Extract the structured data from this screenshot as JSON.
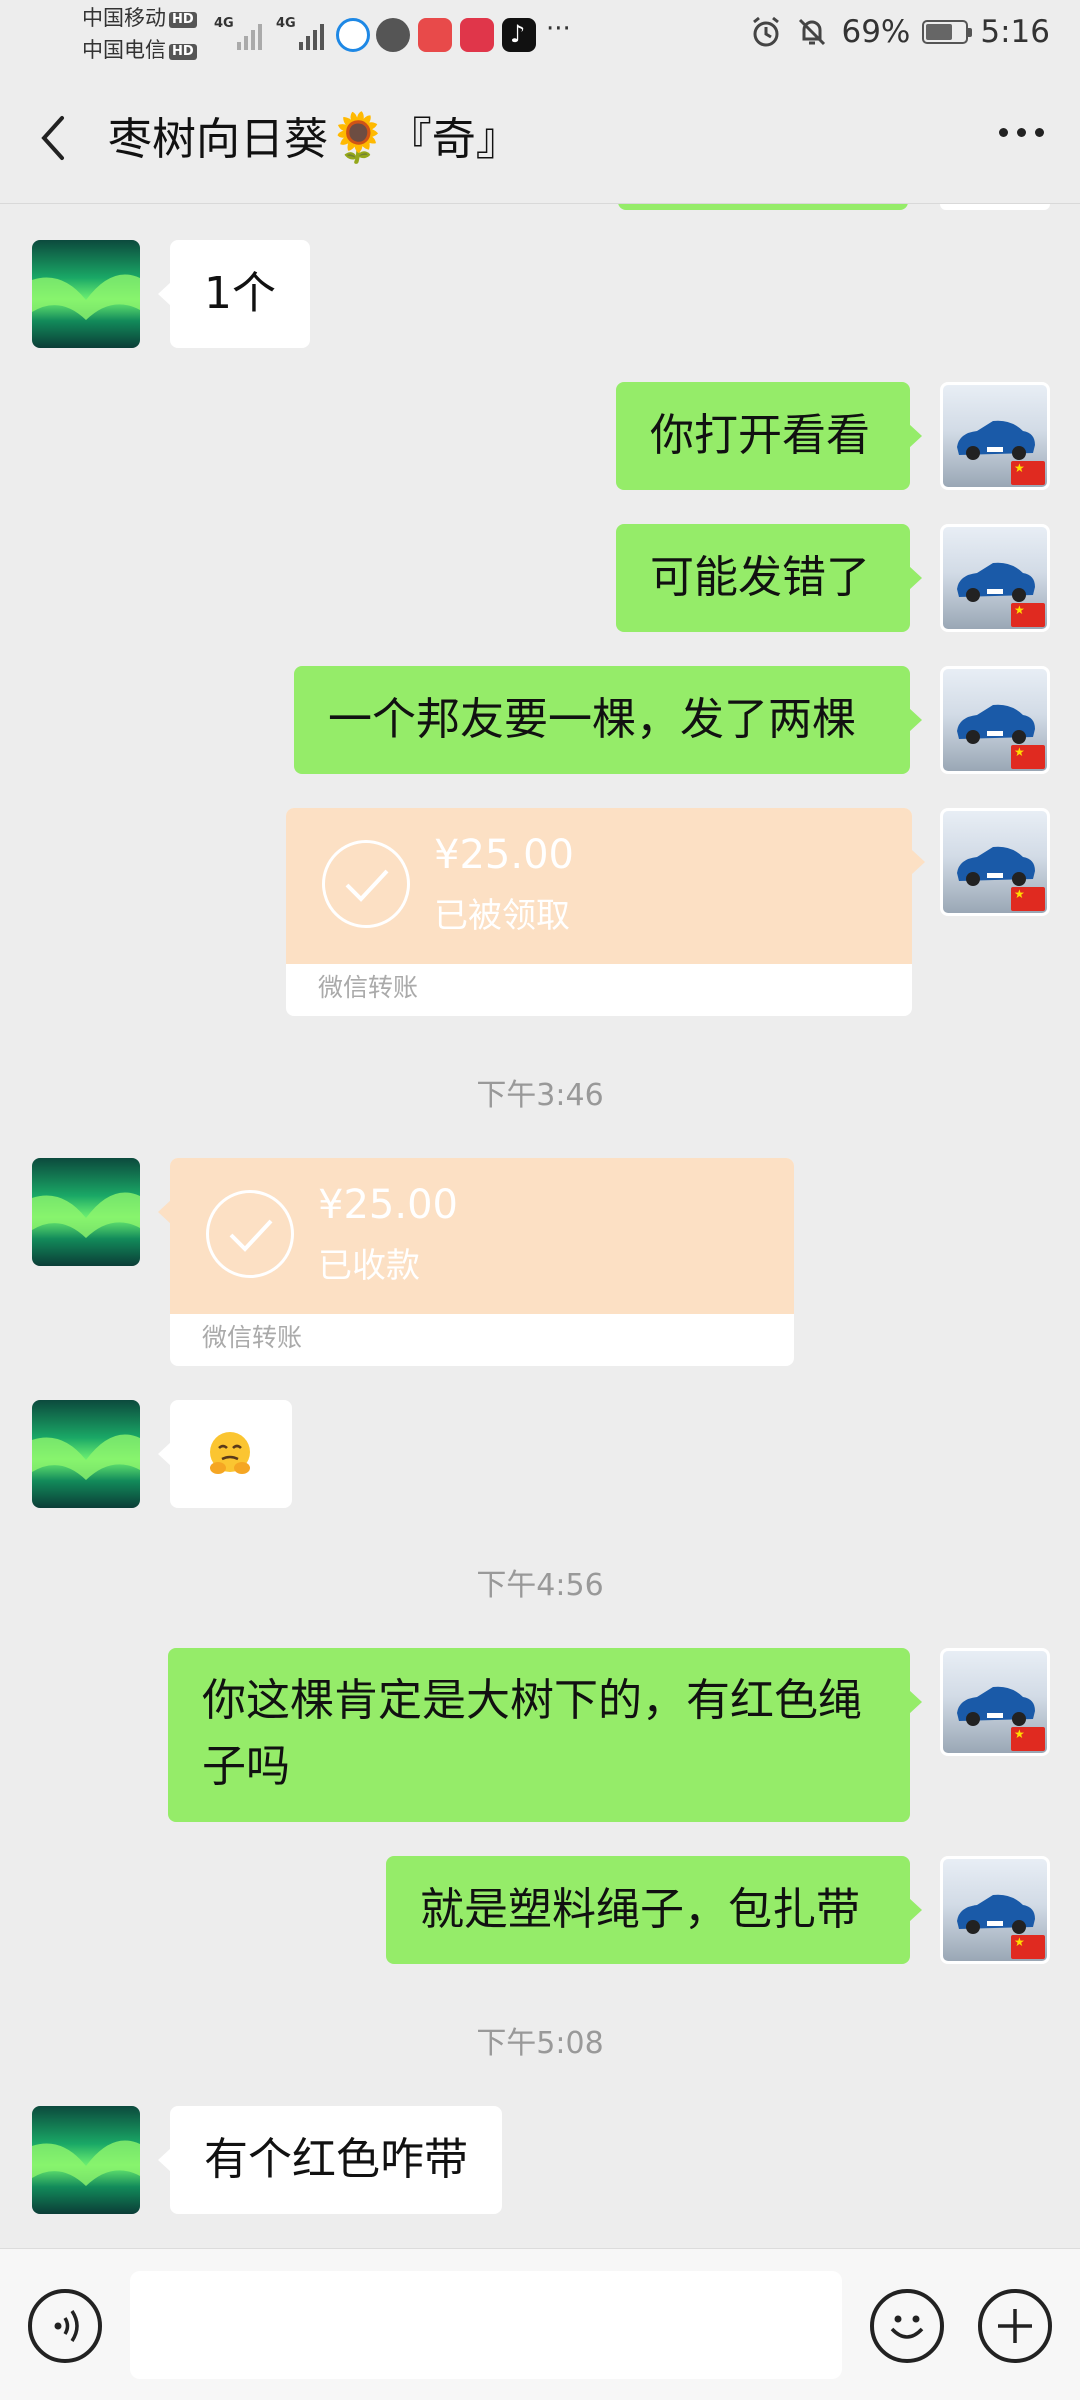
{
  "status_bar": {
    "carrier_1": "中国移动",
    "carrier_2": "中国电信",
    "hd_badge": "HD",
    "net_1": "4G",
    "net_2": "4G",
    "more_indicator": "···",
    "battery_percent": "69%",
    "time": "5:16",
    "battery_level": 0.69,
    "icons": [
      "alarm-icon",
      "mute-bell-icon",
      "battery-icon"
    ]
  },
  "header": {
    "title": "枣树向日葵",
    "title_emoji": "🌻",
    "title_suffix": "『奇』"
  },
  "messages": [
    {
      "side": "left",
      "type": "text",
      "text": "1个"
    },
    {
      "side": "right",
      "type": "text",
      "text": "你打开看看"
    },
    {
      "side": "right",
      "type": "text",
      "text": "可能发错了"
    },
    {
      "side": "right",
      "type": "text",
      "text": "一个邦友要一棵，发了两棵"
    },
    {
      "side": "right",
      "type": "transfer",
      "amount": "¥25.00",
      "status": "已被领取",
      "footer": "微信转账"
    },
    {
      "type": "timestamp",
      "text": "下午3:46"
    },
    {
      "side": "left",
      "type": "transfer",
      "amount": "¥25.00",
      "status": "已收款",
      "footer": "微信转账"
    },
    {
      "side": "left",
      "type": "emoji",
      "emoji": "grimacing-hands-emoji"
    },
    {
      "type": "timestamp",
      "text": "下午4:56"
    },
    {
      "side": "right",
      "type": "text",
      "text": "你这棵肯定是大树下的，有红色绳子吗"
    },
    {
      "side": "right",
      "type": "text",
      "text": "就是塑料绳子，包扎带"
    },
    {
      "type": "timestamp",
      "text": "下午5:08"
    },
    {
      "side": "left",
      "type": "text",
      "text": "有个红色咋带"
    }
  ],
  "input_bar": {
    "placeholder": "",
    "icons": [
      "voice-icon",
      "emoji-icon",
      "plus-icon"
    ]
  },
  "colors": {
    "background": "#ededed",
    "green_bubble": "#95ec69",
    "white_bubble": "#ffffff",
    "transfer_orange": "#fce0c4"
  }
}
